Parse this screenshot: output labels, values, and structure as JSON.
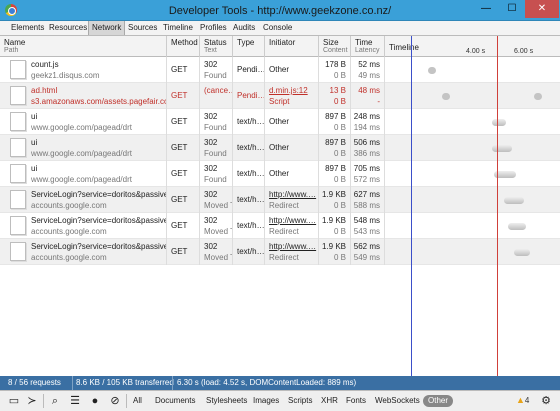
{
  "window": {
    "title": "Developer Tools - http://www.geekzone.co.nz/",
    "minimize": "—",
    "maximize": "☐",
    "close": "✕"
  },
  "tabs": [
    "Elements",
    "Resources",
    "Network",
    "Sources",
    "Timeline",
    "Profiles",
    "Audits",
    "Console"
  ],
  "active_tab": "Network",
  "columns": {
    "name": [
      "Name",
      "Path"
    ],
    "method": [
      "Method",
      ""
    ],
    "status": [
      "Status",
      "Text"
    ],
    "type": [
      "Type",
      ""
    ],
    "initiator": [
      "Initiator",
      ""
    ],
    "size": [
      "Size",
      "Content"
    ],
    "time": [
      "Time",
      "Latency"
    ],
    "timeline": "Timeline",
    "ticks": [
      "4.00 s",
      "6.00 s"
    ]
  },
  "rows": [
    {
      "name": "count.js",
      "path": "geekz1.disqus.com",
      "method": "GET",
      "status": "302",
      "status_text": "Found",
      "type": "Pendi…",
      "initiator": "Other",
      "initiator2": "",
      "size": "178 B",
      "content": "0 B",
      "time": "52 ms",
      "latency": "49 ms",
      "error": false
    },
    {
      "name": "ad.html",
      "path": "s3.amazonaws.com/assets.pagefair.com/",
      "method": "GET",
      "status": "(cance…",
      "status_text": "",
      "type": "Pendi…",
      "initiator": "d.min.js:12",
      "initiator2": "Script",
      "size": "13 B",
      "content": "0 B",
      "time": "48 ms",
      "latency": "-",
      "error": true
    },
    {
      "name": "ui",
      "path": "www.google.com/pagead/drt",
      "method": "GET",
      "status": "302",
      "status_text": "Found",
      "type": "text/h…",
      "initiator": "Other",
      "initiator2": "",
      "size": "897 B",
      "content": "0 B",
      "time": "248 ms",
      "latency": "194 ms",
      "error": false
    },
    {
      "name": "ui",
      "path": "www.google.com/pagead/drt",
      "method": "GET",
      "status": "302",
      "status_text": "Found",
      "type": "text/h…",
      "initiator": "Other",
      "initiator2": "",
      "size": "897 B",
      "content": "0 B",
      "time": "506 ms",
      "latency": "386 ms",
      "error": false
    },
    {
      "name": "ui",
      "path": "www.google.com/pagead/drt",
      "method": "GET",
      "status": "302",
      "status_text": "Found",
      "type": "text/h…",
      "initiator": "Other",
      "initiator2": "",
      "size": "897 B",
      "content": "0 B",
      "time": "705 ms",
      "latency": "572 ms",
      "error": false
    },
    {
      "name": "ServiceLogin?service=doritos&passive…",
      "path": "accounts.google.com",
      "method": "GET",
      "status": "302",
      "status_text": "Moved T",
      "type": "text/h…",
      "initiator": "http://www.…",
      "initiator2": "Redirect",
      "size": "1.9 KB",
      "content": "0 B",
      "time": "627 ms",
      "latency": "588 ms",
      "error": false
    },
    {
      "name": "ServiceLogin?service=doritos&passive…",
      "path": "accounts.google.com",
      "method": "GET",
      "status": "302",
      "status_text": "Moved T",
      "type": "text/h…",
      "initiator": "http://www.…",
      "initiator2": "Redirect",
      "size": "1.9 KB",
      "content": "0 B",
      "time": "548 ms",
      "latency": "543 ms",
      "error": false
    },
    {
      "name": "ServiceLogin?service=doritos&passive…",
      "path": "accounts.google.com",
      "method": "GET",
      "status": "302",
      "status_text": "Moved T",
      "type": "text/h…",
      "initiator": "http://www.…",
      "initiator2": "Redirect",
      "size": "1.9 KB",
      "content": "0 B",
      "time": "562 ms",
      "latency": "549 ms",
      "error": false
    }
  ],
  "summary": {
    "requests": "8 / 56 requests",
    "transferred": "8.6 KB / 105 KB transferred",
    "timing": "6.30 s (load: 4.52 s, DOMContentLoaded: 889 ms)"
  },
  "toolbar": {
    "filters": [
      "All",
      "Documents",
      "Stylesheets",
      "Images",
      "Scripts",
      "XHR",
      "Fonts",
      "WebSockets",
      "Other"
    ],
    "active_filter": "Other",
    "warnings": "4"
  },
  "colors": {
    "title_bar": "#3aa0d8",
    "summary_bar": "#3a6fa3",
    "error_text": "#c0302a",
    "dom_content_line": "#3b4fc9",
    "load_line": "#d0403a"
  }
}
